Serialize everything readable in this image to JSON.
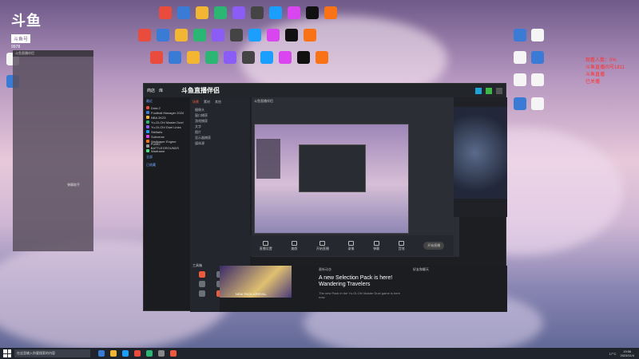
{
  "logo": {
    "title": "斗鱼",
    "sub": "斗鱼号",
    "id": "9978"
  },
  "red_text": [
    "观看人数：0%",
    "斗鱼直播间号1811",
    "斗鱼直播",
    "已关播"
  ],
  "overlay_panel": {
    "title": "斗鱼直播伴侣",
    "note": "弹幕助手"
  },
  "app": {
    "brand": "斗鱼直播伴侣",
    "tabs": [
      "商店",
      "库"
    ],
    "sidebar_sections": [
      "最近",
      "全部",
      "已收藏"
    ],
    "games": [
      "Dota 2",
      "Football Manager 2024",
      "NBA 2K23",
      "Yu-Gi-Oh! Master Duel",
      "Yu-Gi-Oh! Duel Links",
      "Stellaris",
      "Subverse",
      "Wallpaper Engine",
      "PUBG: BATTLEGROUNDS",
      "Warframe"
    ],
    "mid_tabs": [
      "场景",
      "素材",
      "其他"
    ],
    "mid_items": [
      "摄像头",
      "窗口捕获",
      "游戏捕获",
      "文字",
      "图片",
      "显示器捕获",
      "媒体源"
    ],
    "tool_title": "工具箱",
    "controls": [
      "直播设置",
      "美颜",
      "开始直播",
      "录像",
      "弹幕",
      "音效"
    ],
    "live_button": "开始直播",
    "news_title": "A new Selection Pack is here! Wandering Travelers",
    "news_small": "最新动态",
    "news_desc": "The new Pack in the Yu-Gi-Oh! Master Duel game is here now.",
    "news_thumb_label": "NEW PACK ARRIVAL",
    "side_label": "好友和聊天"
  },
  "taskbar": {
    "search": "在这里输入你要搜索的内容",
    "temp": "17°C",
    "time": "19:56",
    "date": "2023/11/4"
  }
}
